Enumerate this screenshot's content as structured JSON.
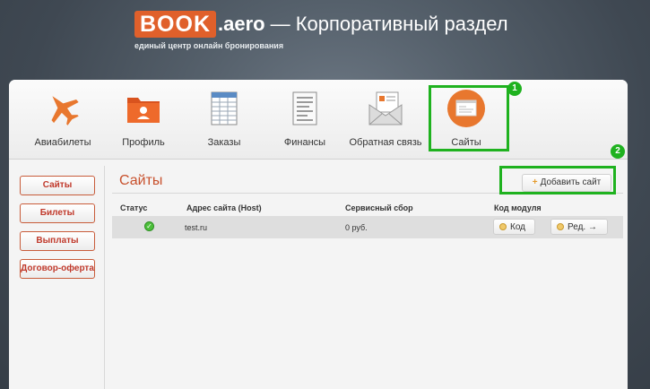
{
  "header": {
    "logo_book": "BOOK",
    "logo_aero": ".aero",
    "title": "— Корпоративный раздел",
    "tagline": "единый центр онлайн бронирования"
  },
  "nav": {
    "items": [
      {
        "label": "Авиабилеты",
        "icon": "airplane-icon"
      },
      {
        "label": "Профиль",
        "icon": "profile-folder-icon"
      },
      {
        "label": "Заказы",
        "icon": "orders-spreadsheet-icon"
      },
      {
        "label": "Финансы",
        "icon": "finance-document-icon"
      },
      {
        "label": "Обратная связь",
        "icon": "feedback-envelope-icon"
      },
      {
        "label": "Сайты",
        "icon": "sites-window-icon",
        "active": true
      }
    ]
  },
  "badges": {
    "one": "1",
    "two": "2"
  },
  "sidebar": {
    "items": [
      {
        "label": "Сайты"
      },
      {
        "label": "Билеты"
      },
      {
        "label": "Выплаты"
      },
      {
        "label": "Договор-оферта"
      }
    ]
  },
  "content": {
    "title": "Сайты",
    "add_button": "Добавить сайт",
    "columns": [
      "Статус",
      "Адрес сайта (Host)",
      "Сервисный сбор",
      "Код модуля"
    ],
    "rows": [
      {
        "status": "ok",
        "host": "test.ru",
        "fee": "0 руб.",
        "code_button": "Код",
        "edit_button": "Ред. →"
      }
    ]
  },
  "colors": {
    "accent": "#e0602b",
    "highlight": "#1fb21f",
    "link_red": "#c8512d"
  }
}
